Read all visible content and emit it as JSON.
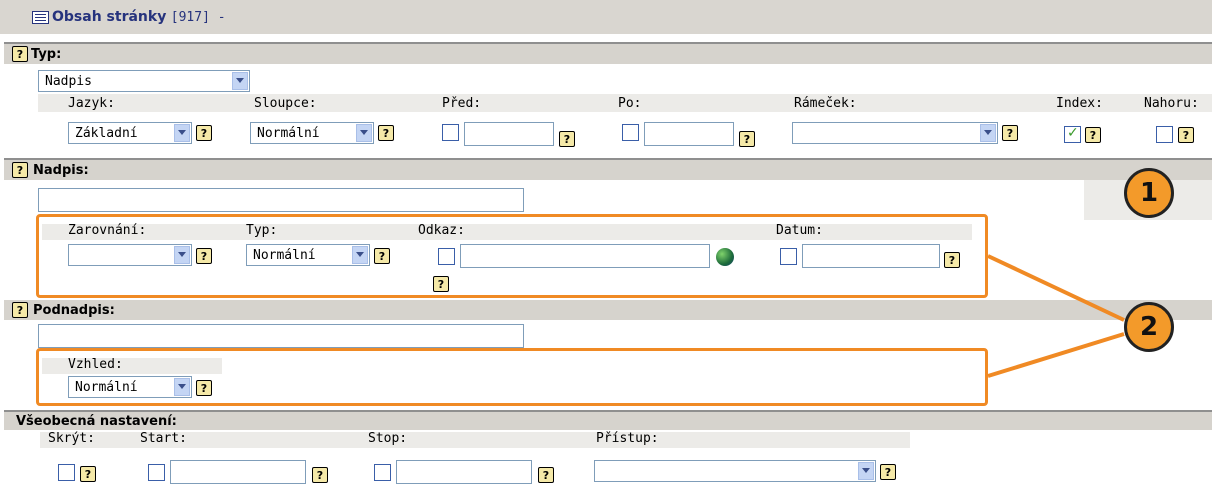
{
  "title": {
    "name": "Obsah stránky",
    "id": "[917] -"
  },
  "typ_section": {
    "heading": "Typ:",
    "type_select": "Nadpis",
    "cols": {
      "jazyk": {
        "label": "Jazyk:",
        "value": "Základní"
      },
      "sloupce": {
        "label": "Sloupce:",
        "value": "Normální"
      },
      "pred": {
        "label": "Před:"
      },
      "po": {
        "label": "Po:"
      },
      "ramecek": {
        "label": "Rámeček:"
      },
      "index": {
        "label": "Index:",
        "checked": true
      },
      "nahoru": {
        "label": "Nahoru:"
      }
    }
  },
  "nadpis_section": {
    "heading": "Nadpis:",
    "zarovnani": {
      "label": "Zarovnání:"
    },
    "typ": {
      "label": "Typ:",
      "value": "Normální"
    },
    "odkaz": {
      "label": "Odkaz:"
    },
    "datum": {
      "label": "Datum:"
    }
  },
  "podnadpis_section": {
    "heading": "Podnadpis:",
    "vzhled": {
      "label": "Vzhled:",
      "value": "Normální"
    }
  },
  "general_section": {
    "heading": "Všeobecná nastavení:",
    "skryt": {
      "label": "Skrýt:"
    },
    "start": {
      "label": "Start:"
    },
    "stop": {
      "label": "Stop:"
    },
    "pristup": {
      "label": "Přístup:"
    }
  },
  "help_glyph": "?",
  "badges": [
    "1",
    "2"
  ],
  "colors": {
    "callout": "#f08a24",
    "header": "#d6d3cd",
    "title_text": "#26337d"
  }
}
